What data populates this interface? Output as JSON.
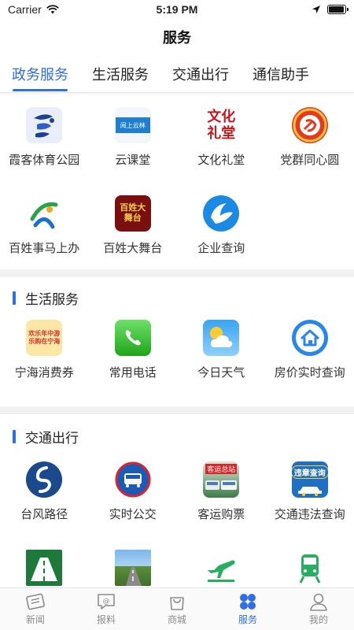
{
  "status": {
    "carrier": "Carrier",
    "time": "5:19 PM",
    "battery_level": 0.95
  },
  "nav": {
    "title": "服务"
  },
  "top_tabs": [
    {
      "label": "政务服务",
      "active": true
    },
    {
      "label": "生活服务",
      "active": false
    },
    {
      "label": "交通出行",
      "active": false
    },
    {
      "label": "通信助手",
      "active": false
    }
  ],
  "gov_services": [
    {
      "label": "霞客体育公园",
      "icon": "sports-park-logo-icon"
    },
    {
      "label": "云课堂",
      "icon": "cloud-classroom-logo-icon",
      "icon_text": "阅上云林"
    },
    {
      "label": "文化礼堂",
      "icon": "culture-hall-logo-icon",
      "icon_text": "文化礼堂"
    },
    {
      "label": "党群同心圆",
      "icon": "party-circle-logo-icon"
    },
    {
      "label": "百姓事马上办",
      "icon": "quick-service-logo-icon"
    },
    {
      "label": "百姓大舞台",
      "icon": "people-stage-logo-icon",
      "icon_text": "百姓大舞台"
    },
    {
      "label": "企业查询",
      "icon": "enterprise-search-logo-icon"
    }
  ],
  "life_section": {
    "title": "生活服务",
    "items": [
      {
        "label": "宁海消费券",
        "icon": "coupon-icon",
        "icon_text": "欢乐年中游 乐购在宁海"
      },
      {
        "label": "常用电话",
        "icon": "phone-icon"
      },
      {
        "label": "今日天气",
        "icon": "weather-icon"
      },
      {
        "label": "房价实时查询",
        "icon": "house-price-icon"
      }
    ]
  },
  "traffic_section": {
    "title": "交通出行",
    "items": [
      {
        "label": "台风路径",
        "icon": "typhoon-path-icon"
      },
      {
        "label": "实时公交",
        "icon": "bus-icon"
      },
      {
        "label": "客运购票",
        "icon": "coach-ticket-icon",
        "icon_text": "客运总站"
      },
      {
        "label": "交通违法查询",
        "icon": "traffic-violation-icon",
        "icon_text": "违章查询"
      },
      {
        "label": "",
        "icon": "highway-icon"
      },
      {
        "label": "",
        "icon": "road-photo-icon"
      },
      {
        "label": "",
        "icon": "airplane-icon"
      },
      {
        "label": "",
        "icon": "train-icon"
      }
    ]
  },
  "tab_bar": [
    {
      "label": "新闻",
      "icon": "news-icon",
      "active": false
    },
    {
      "label": "报料",
      "icon": "report-icon",
      "active": false
    },
    {
      "label": "商城",
      "icon": "shop-icon",
      "active": false
    },
    {
      "label": "服务",
      "icon": "service-icon",
      "active": true
    },
    {
      "label": "我的",
      "icon": "profile-icon",
      "active": false
    }
  ],
  "colors": {
    "accent": "#2f6ee6",
    "divider": "#f2f2f2"
  }
}
